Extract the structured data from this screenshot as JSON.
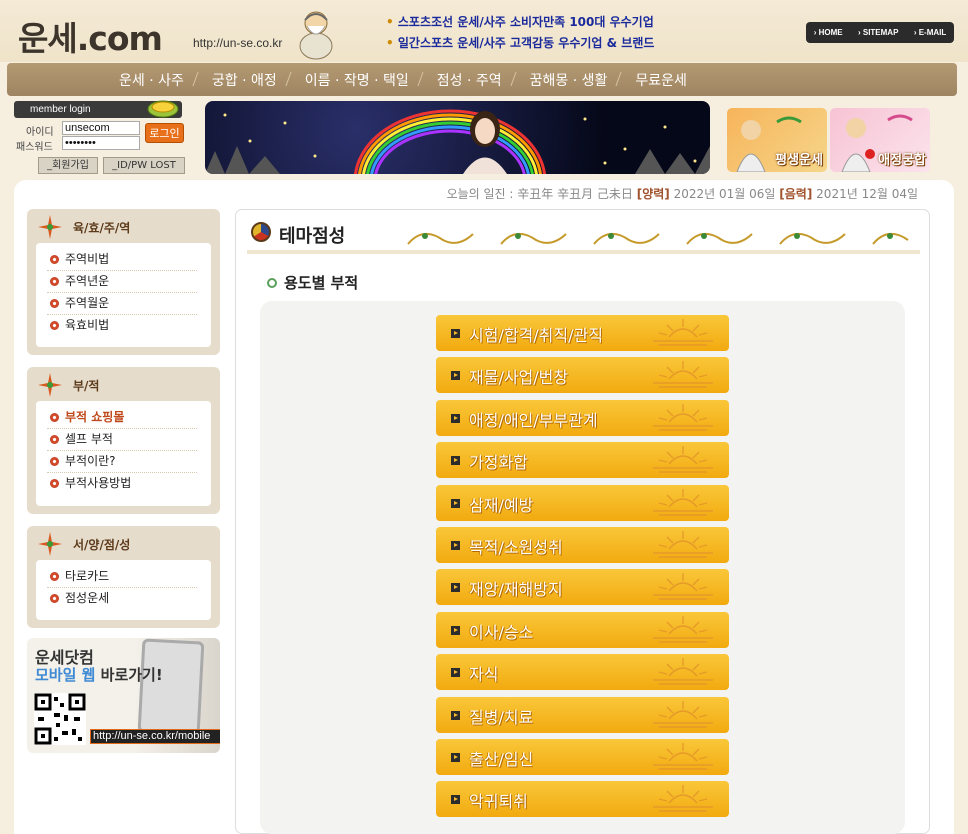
{
  "header": {
    "logo_text": "운세.com",
    "url_text": "http://un-se.co.kr",
    "promo_lines": [
      "스포츠조선 운세/사주 소비자만족 100대 우수기업",
      "일간스포츠 운세/사주 고객감동 우수기업 & 브랜드"
    ],
    "top_links": [
      "HOME",
      "SITEMAP",
      "E-MAIL"
    ]
  },
  "menu": [
    "운세 · 사주",
    "궁합 · 애정",
    "이름 · 작명 · 택일",
    "점성 · 주역",
    "꿈해몽 · 생활",
    "무료운세"
  ],
  "login": {
    "title": "member login",
    "id_label": "아이디",
    "pw_label": "패스워드",
    "id_value": "unsecom",
    "pw_value": "••••••••",
    "login_button": "로그인",
    "join_button": "_회원가입",
    "lost_button": "_ID/PW LOST"
  },
  "banner_boxes": [
    "평생운세",
    "애정궁합"
  ],
  "dateline": {
    "prefix": "오늘의 일진 : 辛丑年 辛丑月 己未日",
    "solar_tag": "[양력]",
    "solar_date": "2022년 01월 06일",
    "lunar_tag": "[음력]",
    "lunar_date": "2021년 12월 04일"
  },
  "sidebar": {
    "boxes": [
      {
        "title": "육/효/주/역",
        "items": [
          "주역비법",
          "주역년운",
          "주역월운",
          "육효비법"
        ]
      },
      {
        "title": "부/적",
        "items": [
          "부적 쇼핑몰",
          "셀프 부적",
          "부적이란?",
          "부적사용방법"
        ]
      },
      {
        "title": "서/양/점/성",
        "items": [
          "타로카드",
          "점성운세"
        ]
      }
    ],
    "mobile_ad": {
      "line1": "운세닷컴",
      "line2_blue": "모바일 웹",
      "line2_rest": " 바로가기!",
      "url": "http://un-se.co.kr/mobile"
    }
  },
  "content": {
    "title": "테마점성",
    "subtitle": "용도별 부적",
    "categories": [
      "시험/합격/취직/관직",
      "재물/사업/번창",
      "애정/애인/부부관계",
      "가정화합",
      "삼재/예방",
      "목적/소원성취",
      "재앙/재해방지",
      "이사/승소",
      "자식",
      "질병/치료",
      "출산/임신",
      "악귀퇴취"
    ]
  },
  "colors": {
    "menu_bar": "#a88d68",
    "category_button": "#f5b81f",
    "highlight_link": "#c0491b",
    "promo_text": "#1a2a9c"
  }
}
